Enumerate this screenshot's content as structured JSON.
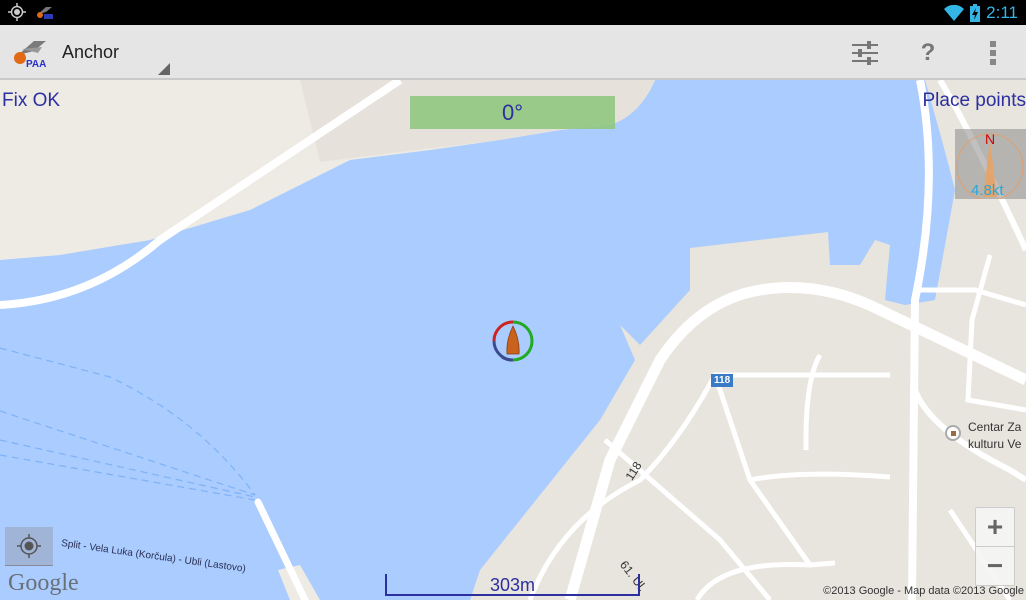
{
  "status_bar": {
    "left_icons": [
      "gps-icon",
      "app-notification-icon"
    ],
    "right_icons": [
      "wifi-icon",
      "battery-charging-icon"
    ],
    "time": "2:11",
    "accent_color": "#33b5e5"
  },
  "action_bar": {
    "app_icon": "anchor-alarm-logo",
    "logo_text": "PAA",
    "title": "Anchor",
    "actions": [
      {
        "name": "settings",
        "icon": "sliders-icon"
      },
      {
        "name": "help",
        "icon": "question-icon",
        "glyph": "?"
      },
      {
        "name": "overflow",
        "icon": "more-vert-icon"
      }
    ]
  },
  "overlay": {
    "fix_status": "Fix OK",
    "heading": "0°",
    "place_points": "Place points",
    "compass": {
      "north_label": "N",
      "speed": "4.8kt"
    },
    "scale_label": "303m",
    "text_color": "#2c2fa0"
  },
  "map": {
    "labels": {
      "ferry_route": "Split - Vela Luka (Korčula) - Ubli (Lastovo)",
      "road_118": "118",
      "road_shield": "118",
      "street": "61. Ul.",
      "poi_line1": "Centar Za",
      "poi_line2": "kulturu Ve"
    },
    "google_logo": "Google",
    "copyright": "©2013 Google - Map data ©2013 Google",
    "zoom_in": "+",
    "zoom_out": "−",
    "colors": {
      "water": "#aaccfe",
      "land": "#e8e4de",
      "road": "#ffffff"
    }
  }
}
